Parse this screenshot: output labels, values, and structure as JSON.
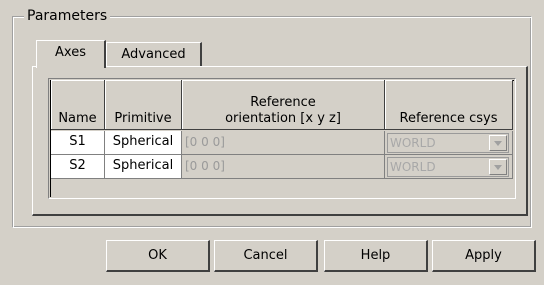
{
  "group": {
    "title": "Parameters"
  },
  "tabs": [
    {
      "label": "Axes",
      "active": true
    },
    {
      "label": "Advanced",
      "active": false
    }
  ],
  "table": {
    "headers": [
      "Name",
      "Primitive",
      "Reference orientation [x y z]",
      "Reference csys"
    ],
    "header_lines": {
      "orientation_line1": "Reference",
      "orientation_line2": "orientation [x y z]"
    },
    "rows": [
      {
        "name": "S1",
        "primitive": "Spherical",
        "orientation": "[0 0 0]",
        "csys": "WORLD"
      },
      {
        "name": "S2",
        "primitive": "Spherical",
        "orientation": "[0 0 0]",
        "csys": "WORLD"
      }
    ]
  },
  "buttons": {
    "ok": "OK",
    "cancel": "Cancel",
    "help": "Help",
    "apply": "Apply"
  }
}
